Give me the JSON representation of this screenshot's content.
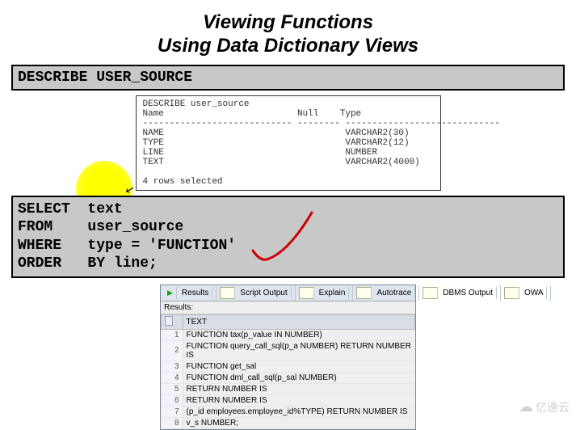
{
  "title": {
    "line1": "Viewing Functions",
    "line2": "Using Data Dictionary Views"
  },
  "box1": {
    "sql": "DESCRIBE USER_SOURCE"
  },
  "desc_output": {
    "header": "DESCRIBE user_source",
    "col_name": "Name",
    "col_null": "Null",
    "col_type": "Type",
    "sep1": "----------------------------",
    "sep2": "--------",
    "sep3": "-----------------------------",
    "rows": [
      {
        "name": "NAME",
        "type": "VARCHAR2(30)"
      },
      {
        "name": "TYPE",
        "type": "VARCHAR2(12)"
      },
      {
        "name": "LINE",
        "type": "NUMBER"
      },
      {
        "name": "TEXT",
        "type": "VARCHAR2(4000)"
      }
    ],
    "footer": "4 rows selected"
  },
  "box2": {
    "line1": "SELECT  text",
    "line2": "FROM    user_source",
    "line3": "WHERE   type = 'FUNCTION'",
    "line4": "ORDER   BY line;"
  },
  "results": {
    "tabs": {
      "results": "Results",
      "script": "Script Output",
      "explain": "Explain",
      "autotrace": "Autotrace",
      "dbms": "DBMS Output",
      "owa": "OWA"
    },
    "header": "Results:",
    "colhead_idx": "",
    "colhead_text": "TEXT",
    "rows": [
      {
        "n": 1,
        "text": "FUNCTION tax(p_value IN NUMBER)"
      },
      {
        "n": 2,
        "text": "FUNCTION query_call_sql(p_a NUMBER) RETURN NUMBER IS"
      },
      {
        "n": 3,
        "text": "FUNCTION get_sal"
      },
      {
        "n": 4,
        "text": "FUNCTION dml_call_sql(p_sal NUMBER)"
      },
      {
        "n": 5,
        "text": "  RETURN NUMBER IS"
      },
      {
        "n": 6,
        "text": "  RETURN NUMBER IS"
      },
      {
        "n": 7,
        "text": " (p_id  employees.employee_id%TYPE) RETURN NUMBER IS"
      },
      {
        "n": 8,
        "text": "  v_s NUMBER;"
      }
    ]
  },
  "watermark": "亿速云"
}
